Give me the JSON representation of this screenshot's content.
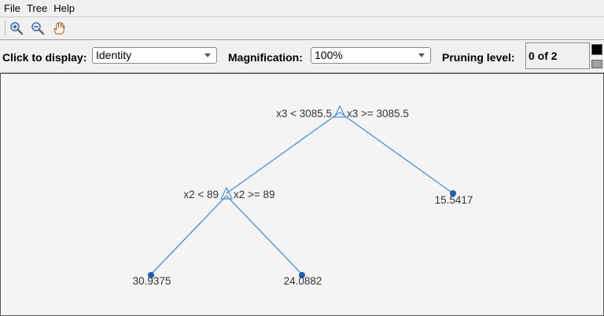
{
  "menu": {
    "items": [
      "File",
      "Tree",
      "Help"
    ]
  },
  "toolbar": {
    "buttons": [
      "zoom-in-icon",
      "zoom-out-icon",
      "pan-hand-icon"
    ]
  },
  "controls": {
    "display_label": "Click to display:",
    "display_value": "Identity",
    "magnification_label": "Magnification:",
    "magnification_value": "100%",
    "pruning_label": "Pruning level:",
    "pruning_value": "0 of 2"
  },
  "colors": {
    "edge": "#4a90d0",
    "leaf": "#1f5fb0",
    "swatch_top": "#000000",
    "swatch_bottom": "#a0a0a0"
  },
  "tree": {
    "splits": [
      {
        "left_label": "x3 < 3085.5",
        "right_label": "x3 >= 3085.5"
      },
      {
        "left_label": "x2 < 89",
        "right_label": "x2 >= 89"
      }
    ],
    "leaves": [
      "30.9375",
      "24.0882",
      "15.5417"
    ]
  }
}
